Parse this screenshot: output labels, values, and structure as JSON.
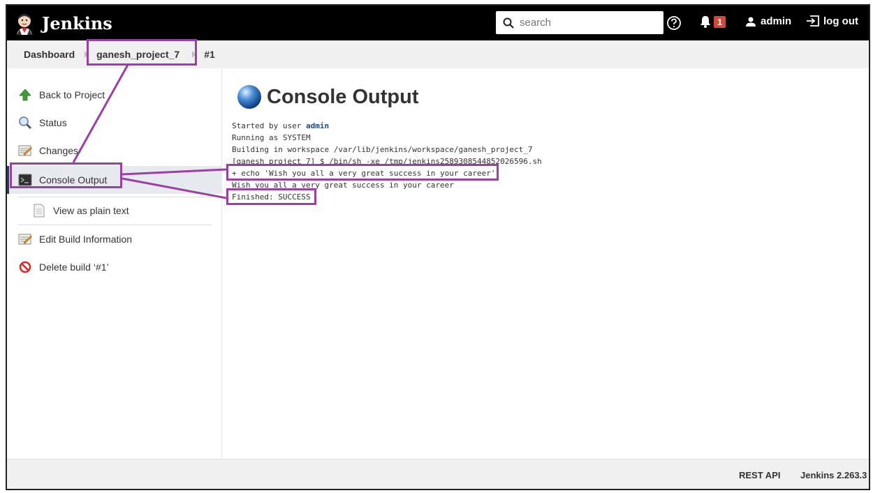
{
  "header": {
    "brand": "Jenkins",
    "search_placeholder": "search",
    "notification_count": "1",
    "user": "admin",
    "logout": "log out"
  },
  "breadcrumb": {
    "items": [
      "Dashboard",
      "ganesh_project_7",
      "#1"
    ]
  },
  "sidebar": {
    "items": [
      {
        "label": "Back to Project",
        "icon": "up-arrow-icon"
      },
      {
        "label": "Status",
        "icon": "magnifier-icon"
      },
      {
        "label": "Changes",
        "icon": "notepad-icon"
      },
      {
        "label": "Console Output",
        "icon": "terminal-icon"
      },
      {
        "label": "View as plain text",
        "icon": "document-icon"
      },
      {
        "label": "Edit Build Information",
        "icon": "notepad-icon"
      },
      {
        "label": "Delete build ‘#1’",
        "icon": "no-entry-icon"
      }
    ]
  },
  "main": {
    "title": "Console Output",
    "console": {
      "started_prefix": "Started by user ",
      "started_user": "admin",
      "lines": [
        "Running as SYSTEM",
        "Building in workspace /var/lib/jenkins/workspace/ganesh_project_7",
        "[ganesh_project_7] $ /bin/sh -xe /tmp/jenkins2589308544852026596.sh",
        "+ echo 'Wish you all a very great success in your career'",
        "Wish you all a very great success in your career",
        "Finished: SUCCESS"
      ]
    }
  },
  "footer": {
    "rest_api": "REST API",
    "version": "Jenkins 2.263.3"
  },
  "colors": {
    "annotation": "#9b3fa6",
    "header_bg": "#000000",
    "badge": "#d24939"
  }
}
